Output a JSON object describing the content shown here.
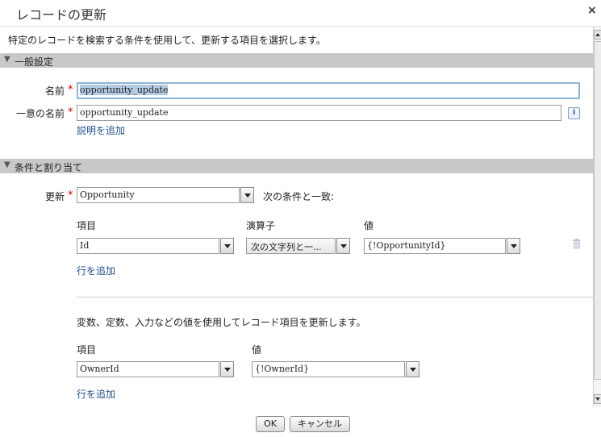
{
  "dialog": {
    "title": "レコードの更新",
    "close_icon": "×"
  },
  "description": "特定のレコードを検索する条件を使用して、更新する項目を選択します。",
  "general": {
    "header": "一般設定",
    "name_label": "名前",
    "name_value": "opportunity_update",
    "unique_name_label": "一意の名前",
    "unique_name_value": "opportunity_update",
    "info_icon": "i",
    "add_description_link": "説明を追加"
  },
  "conditions": {
    "header": "条件と割り当て",
    "update_label": "更新",
    "object_value": "Opportunity",
    "match_text": "次の条件と一致:",
    "columns": {
      "field": "項目",
      "operator": "演算子",
      "value": "値"
    },
    "rows": [
      {
        "field": "Id",
        "operator": "次の文字列と一...",
        "value": "{!OpportunityId}"
      }
    ],
    "add_row_link": "行を追加"
  },
  "assignments": {
    "description": "変数、定数、入力などの値を使用してレコード項目を更新します。",
    "columns": {
      "field": "項目",
      "value": "値"
    },
    "rows": [
      {
        "field": "OwnerId",
        "value": "{!OwnerId}"
      }
    ],
    "add_row_link": "行を追加"
  },
  "footer": {
    "ok_label": "OK",
    "cancel_label": "キャンセル"
  },
  "required_marker": "*",
  "collapse_icon": "▼",
  "colors": {
    "section_bg": "#c8c8c8",
    "link": "#1f4f8f",
    "required": "#c00000"
  }
}
